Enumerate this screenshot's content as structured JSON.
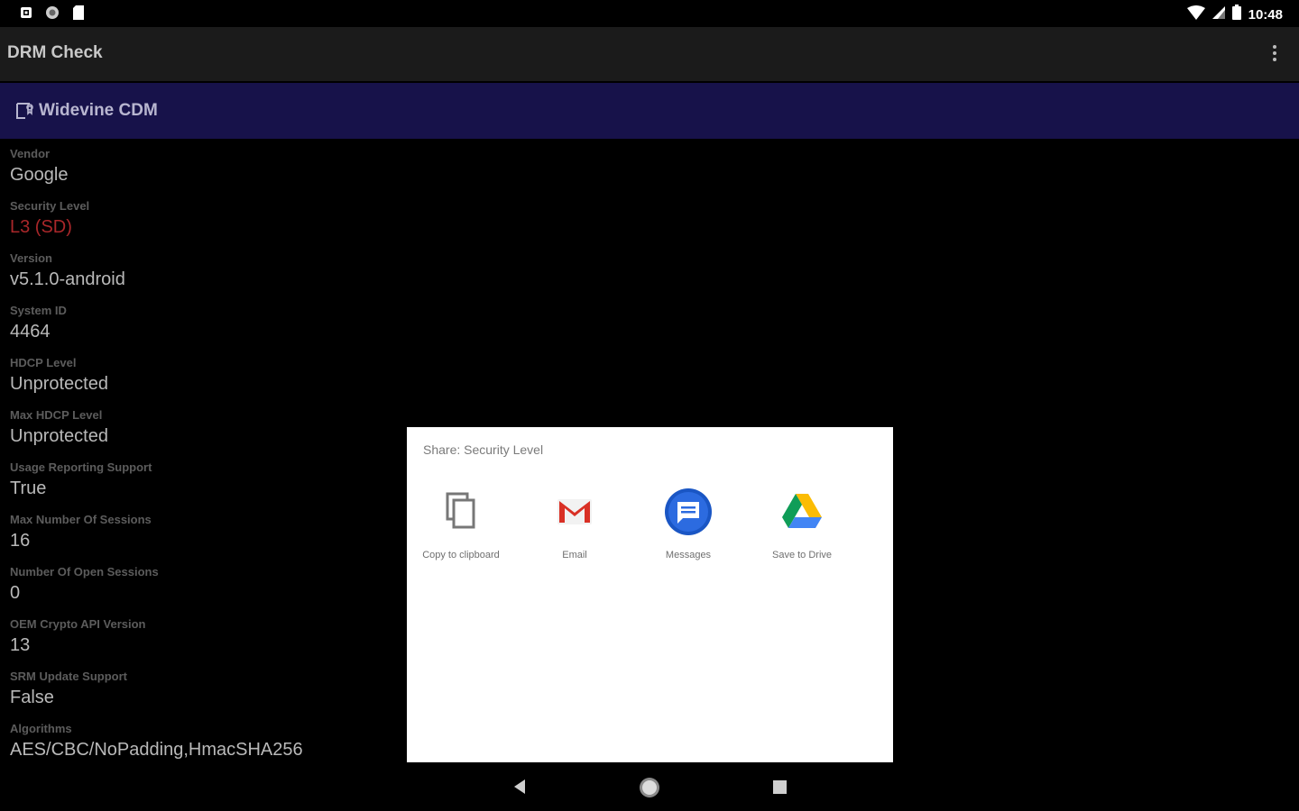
{
  "status_bar": {
    "time": "10:48",
    "left_icons": [
      "app-notification-icon",
      "sync-icon",
      "sd-card-icon"
    ],
    "right_icons": [
      "wifi-icon",
      "cell-signal-icon",
      "battery-icon"
    ]
  },
  "app_bar": {
    "title": "DRM Check",
    "menu_icon": "overflow-menu-icon"
  },
  "section": {
    "title": "Widevine CDM",
    "icon": "certificate-icon",
    "color": "#17124a"
  },
  "properties": [
    {
      "label": "Vendor",
      "value": "Google"
    },
    {
      "label": "Security Level",
      "value": "L3 (SD)",
      "color": "#a9272a"
    },
    {
      "label": "Version",
      "value": "v5.1.0-android"
    },
    {
      "label": "System ID",
      "value": "4464"
    },
    {
      "label": "HDCP Level",
      "value": "Unprotected"
    },
    {
      "label": "Max HDCP Level",
      "value": "Unprotected"
    },
    {
      "label": "Usage Reporting Support",
      "value": "True"
    },
    {
      "label": "Max Number Of Sessions",
      "value": "16"
    },
    {
      "label": "Number Of Open Sessions",
      "value": "0"
    },
    {
      "label": "OEM Crypto API Version",
      "value": "13"
    },
    {
      "label": "SRM Update Support",
      "value": "False"
    },
    {
      "label": "Algorithms",
      "value": "AES/CBC/NoPadding,HmacSHA256"
    }
  ],
  "share_dialog": {
    "title": "Share: Security Level",
    "targets": [
      {
        "label": "Copy to clipboard",
        "icon": "copy-icon"
      },
      {
        "label": "Email",
        "icon": "gmail-icon"
      },
      {
        "label": "Messages",
        "icon": "messages-icon"
      },
      {
        "label": "Save to Drive",
        "icon": "drive-icon"
      }
    ]
  },
  "nav_bar": {
    "buttons": [
      "back-icon",
      "home-icon",
      "recents-icon"
    ]
  }
}
